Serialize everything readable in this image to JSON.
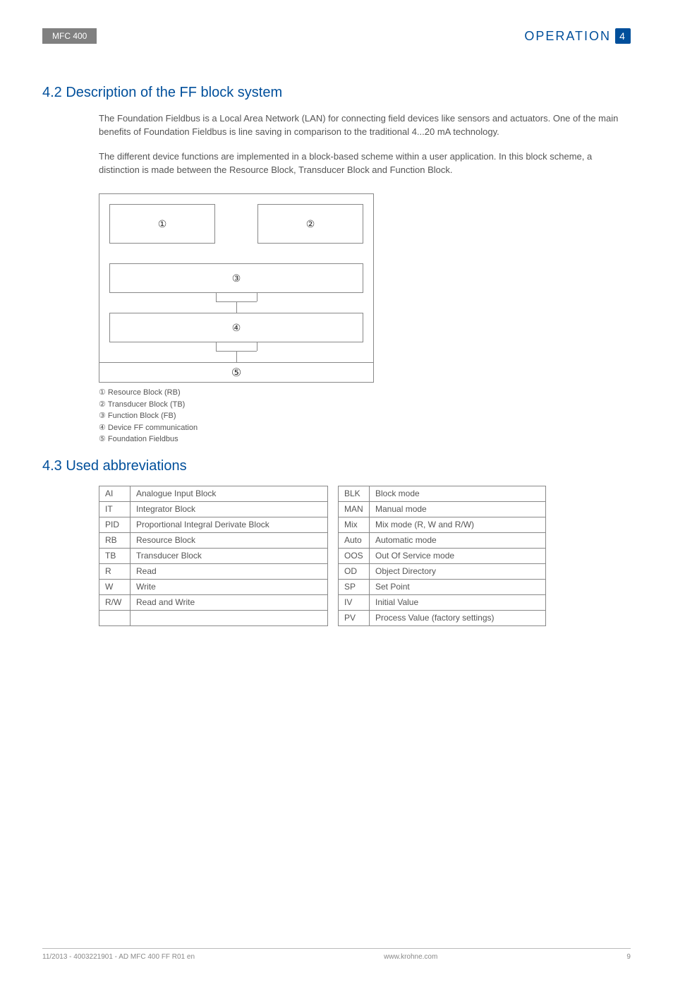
{
  "header": {
    "product": "MFC 400",
    "section_title": "OPERATION",
    "section_num": "4"
  },
  "section42": {
    "heading": "4.2  Description of the FF block system",
    "para1": "The Foundation Fieldbus is a Local Area Network (LAN) for connecting field devices like sensors and actuators. One of the main benefits of Foundation Fieldbus is line saving in comparison to the traditional 4...20 mA technology.",
    "para2": "The different device functions are implemented in a block-based scheme within a user application. In this block scheme, a distinction is made between the Resource Block, Transducer Block and Function Block.",
    "diagram": {
      "n1": "①",
      "n2": "②",
      "n3": "③",
      "n4": "④",
      "n5": "⑤"
    },
    "legend": {
      "l1": "①  Resource Block (RB)",
      "l2": "②  Transducer Block (TB)",
      "l3": "③  Function Block (FB)",
      "l4": "④  Device FF communication",
      "l5": "⑤  Foundation Fieldbus"
    }
  },
  "section43": {
    "heading": "4.3  Used abbreviations",
    "left": [
      {
        "code": "AI",
        "desc": "Analogue Input Block"
      },
      {
        "code": "IT",
        "desc": "Integrator Block"
      },
      {
        "code": "PID",
        "desc": "Proportional Integral Derivate Block"
      },
      {
        "code": "RB",
        "desc": "Resource Block"
      },
      {
        "code": "TB",
        "desc": "Transducer Block"
      },
      {
        "code": "R",
        "desc": "Read"
      },
      {
        "code": "W",
        "desc": "Write"
      },
      {
        "code": "R/W",
        "desc": "Read and Write"
      },
      {
        "code": "",
        "desc": ""
      }
    ],
    "right": [
      {
        "code": "BLK",
        "desc": "Block mode"
      },
      {
        "code": "MAN",
        "desc": "Manual mode"
      },
      {
        "code": "Mix",
        "desc": "Mix mode (R, W and R/W)"
      },
      {
        "code": "Auto",
        "desc": "Automatic mode"
      },
      {
        "code": "OOS",
        "desc": "Out Of Service mode"
      },
      {
        "code": "OD",
        "desc": "Object Directory"
      },
      {
        "code": "SP",
        "desc": "Set Point"
      },
      {
        "code": "IV",
        "desc": "Initial Value"
      },
      {
        "code": "PV",
        "desc": "Process Value (factory settings)"
      }
    ]
  },
  "footer": {
    "left": "11/2013 - 4003221901 - AD MFC 400 FF R01 en",
    "center": "www.krohne.com",
    "right": "9"
  }
}
